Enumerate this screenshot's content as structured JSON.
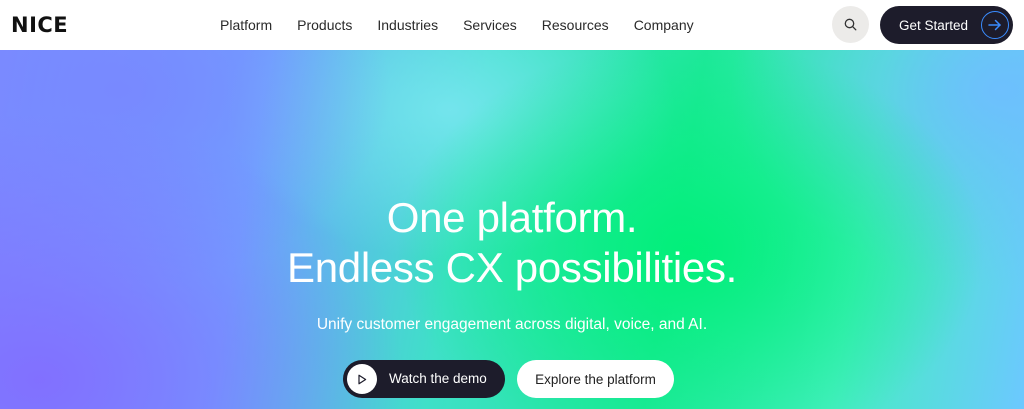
{
  "brand": {
    "logo_text": "NICE"
  },
  "nav": {
    "links": [
      "Platform",
      "Products",
      "Industries",
      "Services",
      "Resources",
      "Company"
    ],
    "search_icon": "search-icon",
    "cta_label": "Get Started",
    "cta_icon": "arrow-right-icon"
  },
  "hero": {
    "title_line1": "One platform.",
    "title_line2": "Endless CX possibilities.",
    "subtitle": "Unify customer engagement across digital, voice, and AI.",
    "primary_button": "Watch the demo",
    "primary_icon": "play-icon",
    "secondary_button": "Explore the platform"
  },
  "colors": {
    "dark_button": "#1d1c2b",
    "accent_arrow": "#3a8cff",
    "search_bg": "#ecebe9",
    "hero_gradient": [
      "#7b8dff",
      "#3fe0c8",
      "#1ee89a",
      "#6cc8ff"
    ]
  }
}
